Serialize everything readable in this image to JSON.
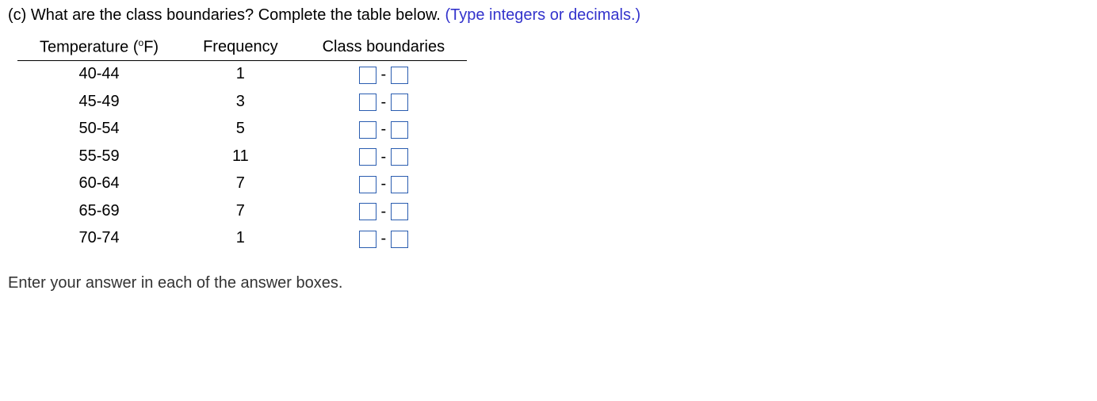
{
  "question": {
    "part_label": "(c)",
    "prompt": "What are the class boundaries? Complete the table below.",
    "hint": "(Type integers or decimals.)"
  },
  "table": {
    "headers": {
      "col1_prefix": "Temperature (",
      "col1_degree": "o",
      "col1_suffix": "F)",
      "col2": "Frequency",
      "col3": "Class boundaries"
    },
    "rows": [
      {
        "range": "40-44",
        "freq": "1",
        "lower": "",
        "upper": ""
      },
      {
        "range": "45-49",
        "freq": "3",
        "lower": "",
        "upper": ""
      },
      {
        "range": "50-54",
        "freq": "5",
        "lower": "",
        "upper": ""
      },
      {
        "range": "55-59",
        "freq": "11",
        "lower": "",
        "upper": ""
      },
      {
        "range": "60-64",
        "freq": "7",
        "lower": "",
        "upper": ""
      },
      {
        "range": "65-69",
        "freq": "7",
        "lower": "",
        "upper": ""
      },
      {
        "range": "70-74",
        "freq": "1",
        "lower": "",
        "upper": ""
      }
    ]
  },
  "footer": "Enter your answer in each of the answer boxes.",
  "dash": "-"
}
